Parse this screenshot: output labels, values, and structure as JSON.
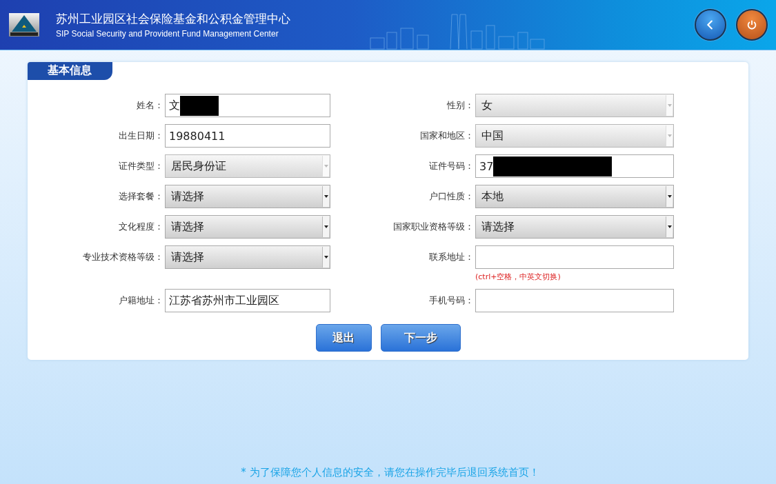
{
  "header": {
    "title": "苏州工业园区社会保险基金和公积金管理中心",
    "subtitle": "SIP Social Security and Provident Fund Management Center"
  },
  "section_tab": "基本信息",
  "fields": [
    {
      "label": "姓名：",
      "kind": "text",
      "value": "文",
      "redacted": true
    },
    {
      "label": "性别：",
      "kind": "select",
      "value": "女",
      "disabled": true
    },
    {
      "label": "出生日期：",
      "kind": "text",
      "value": "19880411",
      "redacted": false
    },
    {
      "label": "国家和地区：",
      "kind": "select",
      "value": "中国",
      "disabled": true
    },
    {
      "label": "证件类型：",
      "kind": "select",
      "value": "居民身份证",
      "disabled": true
    },
    {
      "label": "证件号码：",
      "kind": "text",
      "value": "37",
      "redacted": true
    },
    {
      "label": "选择套餐：",
      "kind": "select",
      "value": "请选择",
      "disabled": false
    },
    {
      "label": "户口性质：",
      "kind": "select",
      "value": "本地",
      "disabled": false
    },
    {
      "label": "文化程度：",
      "kind": "select",
      "value": "请选择",
      "disabled": false
    },
    {
      "label": "国家职业资格等级：",
      "kind": "select",
      "value": "请选择",
      "disabled": false
    },
    {
      "label": "专业技术资格等级：",
      "kind": "select",
      "value": "请选择",
      "disabled": false
    },
    {
      "label": "联系地址：",
      "kind": "text",
      "hint": "(ctrl+空格，中英文切换)",
      "redacted": false
    },
    {
      "label": "户籍地址：",
      "kind": "text",
      "value": "江苏省苏州市工业园区",
      "redacted": false
    },
    {
      "label": "手机号码：",
      "kind": "text",
      "redacted": false
    }
  ],
  "buttons": [
    {
      "label": "退出",
      "kind": "exit"
    },
    {
      "label": "下一步",
      "kind": "next"
    }
  ],
  "footer_note": "* 为了保障您个人信息的安全，请您在操作完毕后退回系统首页！"
}
